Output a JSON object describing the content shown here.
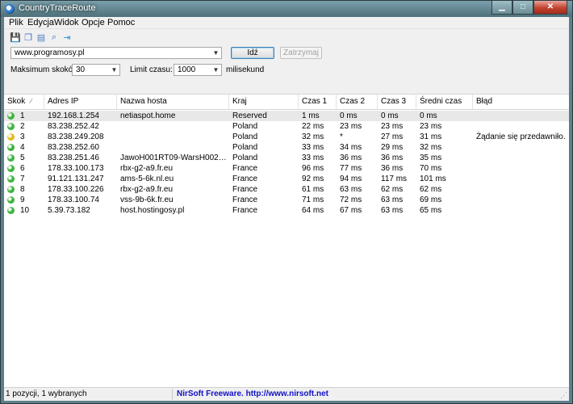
{
  "window": {
    "title": "CountryTraceRoute"
  },
  "menu": [
    "Plik",
    "Edycja",
    "Widok",
    "Opcje",
    "Pomoc"
  ],
  "toolbar": [
    {
      "name": "save-icon",
      "glyph": "💾",
      "color": "#2d57a8"
    },
    {
      "name": "copy-icon",
      "glyph": "❐",
      "color": "#3a6fc4"
    },
    {
      "name": "report-icon",
      "glyph": "▤",
      "color": "#4d7fbf"
    },
    {
      "name": "find-icon",
      "glyph": "⌕",
      "color": "#3a6fc4"
    },
    {
      "name": "exit-icon",
      "glyph": "⇥",
      "color": "#2f8fcf"
    }
  ],
  "controls": {
    "url": "www.programosy.pl",
    "go_label": "Idź",
    "stop_label": "Zatrzymaj",
    "max_hops_label": "Maksimum skoków:",
    "max_hops_value": "30",
    "timeout_label": "Limit czasu:",
    "timeout_value": "1000",
    "timeout_unit": "milisekund"
  },
  "columns": [
    "Skok",
    "Adres IP",
    "Nazwa hosta",
    "Kraj",
    "Czas 1",
    "Czas 2",
    "Czas 3",
    "Średni czas",
    "Błąd"
  ],
  "rows": [
    {
      "status": "#3db33d",
      "hop": "1",
      "ip": "192.168.1.254",
      "host": "netiaspot.home",
      "country": "Reserved",
      "t1": "1 ms",
      "t2": "0 ms",
      "t3": "0 ms",
      "avg": "0 ms",
      "error": ""
    },
    {
      "status": "#3db33d",
      "hop": "2",
      "ip": "83.238.252.42",
      "host": "",
      "country": "Poland",
      "t1": "22 ms",
      "t2": "23 ms",
      "t3": "23 ms",
      "avg": "23 ms",
      "error": ""
    },
    {
      "status": "#e6b81c",
      "hop": "3",
      "ip": "83.238.249.208",
      "host": "",
      "country": "Poland",
      "t1": "32 ms",
      "t2": "*",
      "t3": "27 ms",
      "avg": "31 ms",
      "error": "Żądanie się przedawniło."
    },
    {
      "status": "#3db33d",
      "hop": "4",
      "ip": "83.238.252.60",
      "host": "",
      "country": "Poland",
      "t1": "33 ms",
      "t2": "34 ms",
      "t3": "29 ms",
      "avg": "32 ms",
      "error": ""
    },
    {
      "status": "#3db33d",
      "hop": "5",
      "ip": "83.238.251.46",
      "host": "JawoH001RT09-WarsH002RT22.in...",
      "country": "Poland",
      "t1": "33 ms",
      "t2": "36 ms",
      "t3": "36 ms",
      "avg": "35 ms",
      "error": ""
    },
    {
      "status": "#3db33d",
      "hop": "6",
      "ip": "178.33.100.173",
      "host": "rbx-g2-a9.fr.eu",
      "country": "France",
      "t1": "96 ms",
      "t2": "77 ms",
      "t3": "36 ms",
      "avg": "70 ms",
      "error": ""
    },
    {
      "status": "#3db33d",
      "hop": "7",
      "ip": "91.121.131.247",
      "host": "ams-5-6k.nl.eu",
      "country": "France",
      "t1": "92 ms",
      "t2": "94 ms",
      "t3": "117 ms",
      "avg": "101 ms",
      "error": ""
    },
    {
      "status": "#3db33d",
      "hop": "8",
      "ip": "178.33.100.226",
      "host": "rbx-g2-a9.fr.eu",
      "country": "France",
      "t1": "61 ms",
      "t2": "63 ms",
      "t3": "62 ms",
      "avg": "62 ms",
      "error": ""
    },
    {
      "status": "#3db33d",
      "hop": "9",
      "ip": "178.33.100.74",
      "host": "vss-9b-6k.fr.eu",
      "country": "France",
      "t1": "71 ms",
      "t2": "72 ms",
      "t3": "63 ms",
      "avg": "69 ms",
      "error": ""
    },
    {
      "status": "#3db33d",
      "hop": "10",
      "ip": "5.39.73.182",
      "host": "host.hostingosy.pl",
      "country": "France",
      "t1": "64 ms",
      "t2": "67 ms",
      "t3": "63 ms",
      "avg": "65 ms",
      "error": ""
    }
  ],
  "status": {
    "left": "1 pozycji, 1 wybranych",
    "link": "NirSoft Freeware.  http://www.nirsoft.net"
  }
}
